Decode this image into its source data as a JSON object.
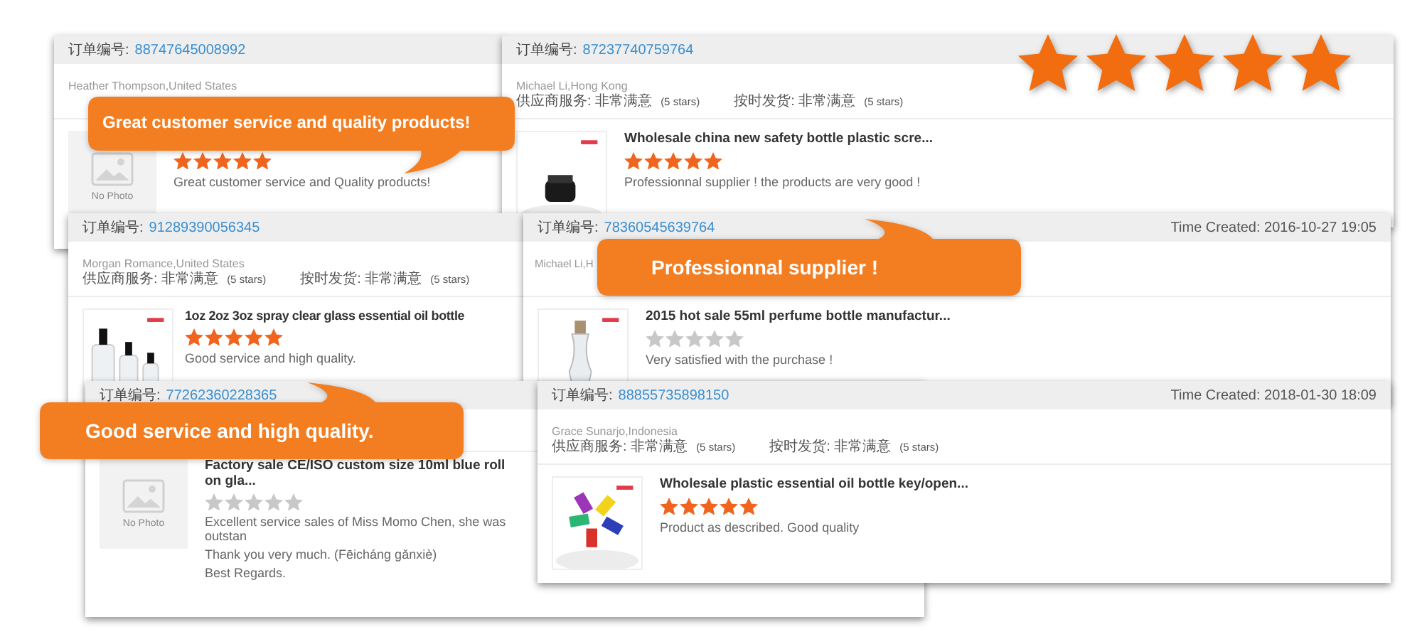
{
  "cards": [
    {
      "order_label": "订单编号:",
      "order_no": "88747645008992",
      "buyer": "Heather Thompson,United States",
      "product": {
        "image_text": "No Photo",
        "stars": 5,
        "review": [
          "Great customer service and Quality products!"
        ]
      }
    },
    {
      "order_label": "订单编号:",
      "order_no": "87237740759764",
      "buyer": "Michael Li,Hong Kong",
      "ratings": [
        {
          "label": "供应商服务: 非常满意",
          "note": "(5 stars)"
        },
        {
          "label": "按时发货: 非常满意",
          "note": "(5 stars)"
        }
      ],
      "product": {
        "title": "Wholesale china new safety bottle plastic scre...",
        "stars": 5,
        "review": [
          "Professionnal supplier ! the products are very good !"
        ]
      }
    },
    {
      "order_label": "订单编号:",
      "order_no": "91289390056345",
      "buyer": "Morgan Romance,United States",
      "ratings": [
        {
          "label": "供应商服务: 非常满意",
          "note": "(5 stars)"
        },
        {
          "label": "按时发货: 非常满意",
          "note": "(5 stars)"
        }
      ],
      "product": {
        "title": "1oz 2oz 3oz spray clear glass essential oil bottle",
        "stars": 5,
        "review": [
          "Good service and high quality."
        ]
      }
    },
    {
      "order_label": "订单编号:",
      "order_no": "78360545639764",
      "time": "Time Created: 2016-10-27 19:05",
      "buyer": "Michael Li,H",
      "product": {
        "title": "2015 hot sale 55ml perfume bottle manufactur...",
        "stars": 0,
        "review": [
          "Very satisfied with the purchase !"
        ]
      }
    },
    {
      "order_label": "订单编号:",
      "order_no": "77262360228365",
      "product": {
        "image_text": "No Photo",
        "title": "Factory sale CE/ISO custom size 10ml blue roll on gla...",
        "stars": 0,
        "review": [
          "Excellent service sales of Miss Momo Chen, she was outstan",
          "Thank you very much. (Fēicháng gǎnxiè)",
          "Best Regards."
        ]
      }
    },
    {
      "order_label": "订单编号:",
      "order_no": "88855735898150",
      "time": "Time Created: 2018-01-30 18:09",
      "buyer": "Grace Sunarjo,Indonesia",
      "ratings": [
        {
          "label": "供应商服务: 非常满意",
          "note": "(5 stars)"
        },
        {
          "label": "按时发货: 非常满意",
          "note": "(5 stars)"
        }
      ],
      "product": {
        "title": "Wholesale plastic essential oil bottle key/open...",
        "stars": 5,
        "review": [
          "Product as described. Good quality"
        ]
      }
    }
  ],
  "bubbles": [
    {
      "text": "Great customer service and quality products!"
    },
    {
      "text": "Professionnal supplier !"
    },
    {
      "text": "Good service and high quality."
    }
  ],
  "big_rating": {
    "stars": 5
  }
}
